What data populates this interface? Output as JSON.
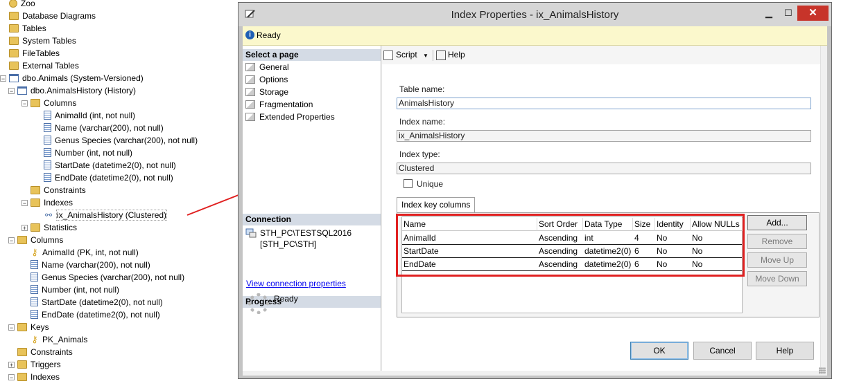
{
  "tree": {
    "items": [
      {
        "label": "Zoo",
        "icon": "database-icon",
        "expander": "",
        "indent": 0
      },
      {
        "label": "Database Diagrams",
        "icon": "folder-icon",
        "expander": "",
        "indent": 0
      },
      {
        "label": "Tables",
        "icon": "folder-icon",
        "expander": "",
        "indent": 0
      },
      {
        "label": "System Tables",
        "icon": "folder-icon",
        "expander": "",
        "indent": 1
      },
      {
        "label": "FileTables",
        "icon": "folder-icon",
        "expander": "",
        "indent": 1
      },
      {
        "label": "External Tables",
        "icon": "folder-icon",
        "expander": "",
        "indent": 1
      },
      {
        "label": "dbo.Animals (System-Versioned)",
        "icon": "table-icon",
        "expander": "−",
        "indent": 1
      },
      {
        "label": "dbo.AnimalsHistory (History)",
        "icon": "table-icon",
        "expander": "−",
        "indent": 2
      },
      {
        "label": "Columns",
        "icon": "folder-icon",
        "expander": "−",
        "indent": 3
      },
      {
        "label": "AnimalId (int, not null)",
        "icon": "column-icon",
        "expander": "",
        "indent": 4
      },
      {
        "label": "Name (varchar(200), not null)",
        "icon": "column-icon",
        "expander": "",
        "indent": 4
      },
      {
        "label": "Genus Species (varchar(200), not null)",
        "icon": "column-icon",
        "expander": "",
        "indent": 4
      },
      {
        "label": "Number (int, not null)",
        "icon": "column-icon",
        "expander": "",
        "indent": 4
      },
      {
        "label": "StartDate (datetime2(0), not null)",
        "icon": "column-icon",
        "expander": "",
        "indent": 4
      },
      {
        "label": "EndDate (datetime2(0), not null)",
        "icon": "column-icon",
        "expander": "",
        "indent": 4
      },
      {
        "label": "Constraints",
        "icon": "folder-icon",
        "expander": "",
        "indent": 3
      },
      {
        "label": "Indexes",
        "icon": "folder-icon",
        "expander": "−",
        "indent": 3
      },
      {
        "label": "ix_AnimalsHistory (Clustered)",
        "icon": "index-icon",
        "expander": "",
        "indent": 4,
        "selected": true
      },
      {
        "label": "Statistics",
        "icon": "folder-icon",
        "expander": "+",
        "indent": 3
      },
      {
        "label": "Columns",
        "icon": "folder-icon",
        "expander": "−",
        "indent": 2
      },
      {
        "label": "AnimalId (PK, int, not null)",
        "icon": "key-icon",
        "expander": "",
        "indent": 3
      },
      {
        "label": "Name (varchar(200), not null)",
        "icon": "column-icon",
        "expander": "",
        "indent": 3
      },
      {
        "label": "Genus Species (varchar(200), not null)",
        "icon": "column-icon",
        "expander": "",
        "indent": 3
      },
      {
        "label": "Number (int, not null)",
        "icon": "column-icon",
        "expander": "",
        "indent": 3
      },
      {
        "label": "StartDate (datetime2(0), not null)",
        "icon": "column-icon",
        "expander": "",
        "indent": 3
      },
      {
        "label": "EndDate (datetime2(0), not null)",
        "icon": "column-icon",
        "expander": "",
        "indent": 3
      },
      {
        "label": "Keys",
        "icon": "folder-icon",
        "expander": "−",
        "indent": 2
      },
      {
        "label": "PK_Animals",
        "icon": "key-icon",
        "expander": "",
        "indent": 3
      },
      {
        "label": "Constraints",
        "icon": "folder-icon",
        "expander": "",
        "indent": 2
      },
      {
        "label": "Triggers",
        "icon": "folder-icon",
        "expander": "+",
        "indent": 2
      },
      {
        "label": "Indexes",
        "icon": "folder-icon",
        "expander": "−",
        "indent": 2
      }
    ]
  },
  "dialog": {
    "title": "Index Properties - ix_AnimalsHistory",
    "status": "Ready",
    "select_page_header": "Select a page",
    "pages": [
      "General",
      "Options",
      "Storage",
      "Fragmentation",
      "Extended Properties"
    ],
    "connection_header": "Connection",
    "connection_server": "STH_PC\\TESTSQL2016",
    "connection_user": "[STH_PC\\STH]",
    "view_connection_link": "View connection properties",
    "progress_header": "Progress",
    "progress_status": "Ready",
    "toolbar": {
      "script": "Script",
      "help": "Help"
    },
    "table_name_label": "Table name:",
    "table_name": "AnimalsHistory",
    "index_name_label": "Index name:",
    "index_name": "ix_AnimalsHistory",
    "index_type_label": "Index type:",
    "index_type": "Clustered",
    "unique_label": "Unique",
    "unique_checked": false,
    "tab_label": "Index key columns",
    "columns_headers": [
      "Name",
      "Sort Order",
      "Data Type",
      "Size",
      "Identity",
      "Allow NULLs"
    ],
    "columns_rows": [
      [
        "AnimalId",
        "Ascending",
        "int",
        "4",
        "No",
        "No"
      ],
      [
        "StartDate",
        "Ascending",
        "datetime2(0)",
        "6",
        "No",
        "No"
      ],
      [
        "EndDate",
        "Ascending",
        "datetime2(0)",
        "6",
        "No",
        "No"
      ]
    ],
    "side_buttons": {
      "add": "Add...",
      "remove": "Remove",
      "move_up": "Move Up",
      "move_down": "Move Down"
    },
    "buttons": {
      "ok": "OK",
      "cancel": "Cancel",
      "help": "Help"
    },
    "highlight_color": "#e02020"
  }
}
